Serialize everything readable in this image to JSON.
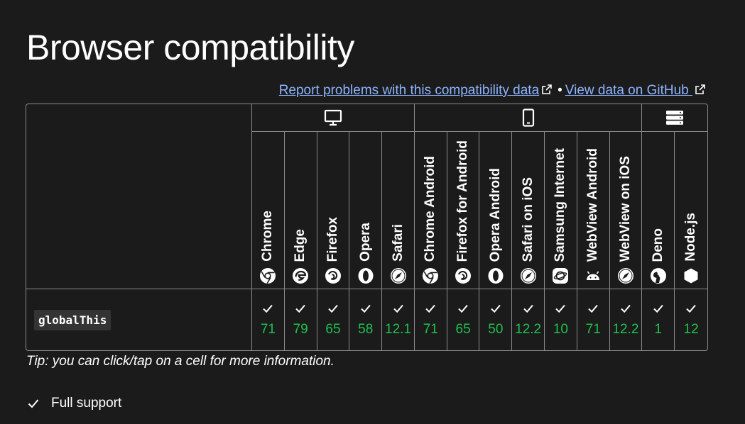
{
  "title": "Browser compatibility",
  "links": {
    "report": "Report problems with this compatibility data",
    "separator": "•",
    "github": "View data on GitHub "
  },
  "platforms": [
    {
      "name": "desktop",
      "icon": "desktop-icon",
      "span": 5
    },
    {
      "name": "mobile",
      "icon": "mobile-icon",
      "span": 7
    },
    {
      "name": "server",
      "icon": "server-icon",
      "span": 2
    }
  ],
  "browsers": [
    {
      "name": "Chrome",
      "icon": "chrome-icon"
    },
    {
      "name": "Edge",
      "icon": "edge-icon"
    },
    {
      "name": "Firefox",
      "icon": "firefox-icon"
    },
    {
      "name": "Opera",
      "icon": "opera-icon"
    },
    {
      "name": "Safari",
      "icon": "safari-icon"
    },
    {
      "name": "Chrome Android",
      "icon": "chrome-icon"
    },
    {
      "name": "Firefox for Android",
      "icon": "firefox-icon"
    },
    {
      "name": "Opera Android",
      "icon": "opera-icon"
    },
    {
      "name": "Safari on iOS",
      "icon": "safari-icon"
    },
    {
      "name": "Samsung Internet",
      "icon": "samsung-internet-icon"
    },
    {
      "name": "WebView Android",
      "icon": "android-icon"
    },
    {
      "name": "WebView on iOS",
      "icon": "safari-icon"
    },
    {
      "name": "Deno",
      "icon": "deno-icon"
    },
    {
      "name": "Node.js",
      "icon": "nodejs-icon"
    }
  ],
  "features": [
    {
      "name": "globalThis",
      "support": [
        "71",
        "79",
        "65",
        "58",
        "12.1",
        "71",
        "65",
        "50",
        "12.2",
        "10",
        "71",
        "12.2",
        "1",
        "12"
      ]
    }
  ],
  "tip": "Tip: you can click/tap on a cell for more information.",
  "legend": [
    {
      "label": "Full support",
      "icon": "check-icon"
    }
  ],
  "colors": {
    "background": "#1b1b1b",
    "link": "#8cb4ff",
    "support": "#1fc14e",
    "border": "#8a8a8a"
  }
}
